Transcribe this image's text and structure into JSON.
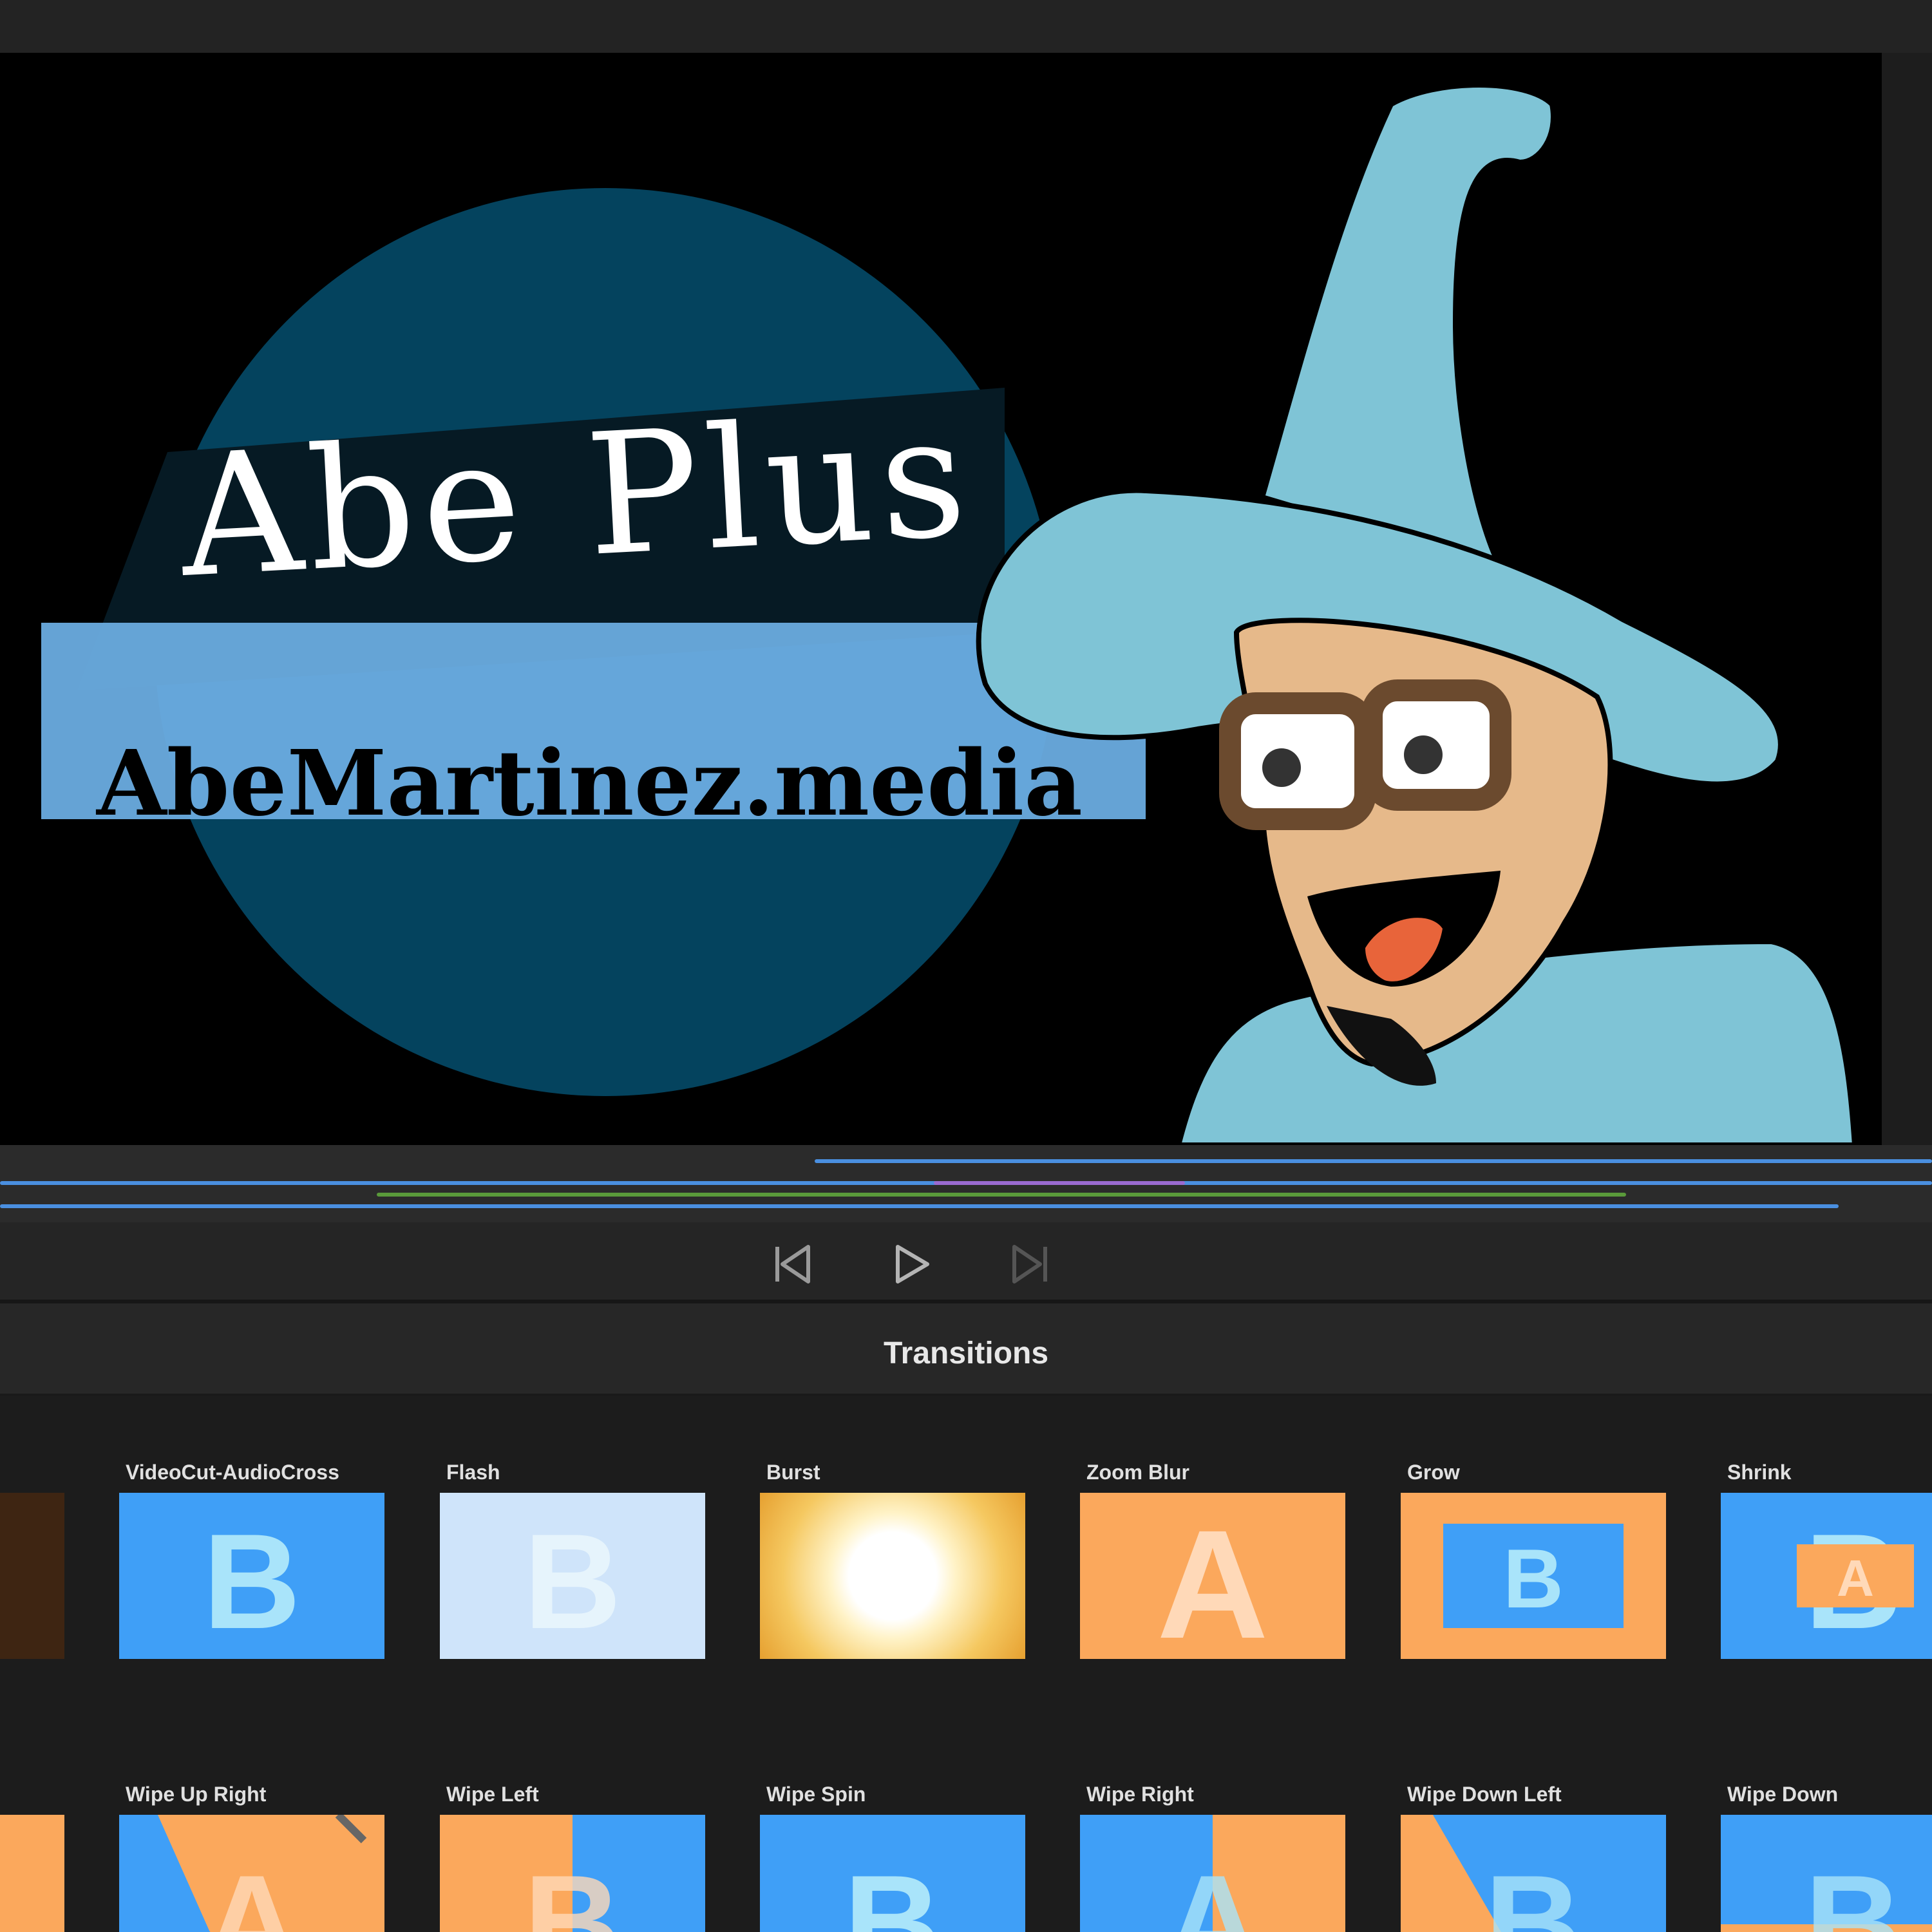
{
  "viewer": {
    "logo_title": "Abe Plus",
    "logo_url": "AbeMartinez.media"
  },
  "transport": {
    "prev_icon": "skip-back-icon",
    "play_icon": "play-icon",
    "next_icon": "skip-forward-icon"
  },
  "panel": {
    "title": "Transitions"
  },
  "transitions": {
    "row1": [
      {
        "label": "VideoCut-AudioCross",
        "letter": "B"
      },
      {
        "label": "Flash",
        "letter": "B"
      },
      {
        "label": "Burst",
        "letter": ""
      },
      {
        "label": "Zoom Blur",
        "letter": "A"
      },
      {
        "label": "Grow",
        "letter": "B"
      },
      {
        "label": "Shrink",
        "letter": "A"
      }
    ],
    "row2": [
      {
        "label": "Wipe Up Right",
        "letter": "A"
      },
      {
        "label": "Wipe Left",
        "letter": "B"
      },
      {
        "label": "Wipe Spin",
        "letter": "B"
      },
      {
        "label": "Wipe Right",
        "letter": "A"
      },
      {
        "label": "Wipe Down Left",
        "letter": "B"
      },
      {
        "label": "Wipe Down",
        "letter": "B"
      }
    ]
  },
  "colors": {
    "clip_a": "#fba85c",
    "clip_b": "#3f9ff7",
    "lane_blue": "#4a8fe0",
    "lane_green": "#5a9a3a",
    "lane_purple": "#9a6ad0"
  }
}
